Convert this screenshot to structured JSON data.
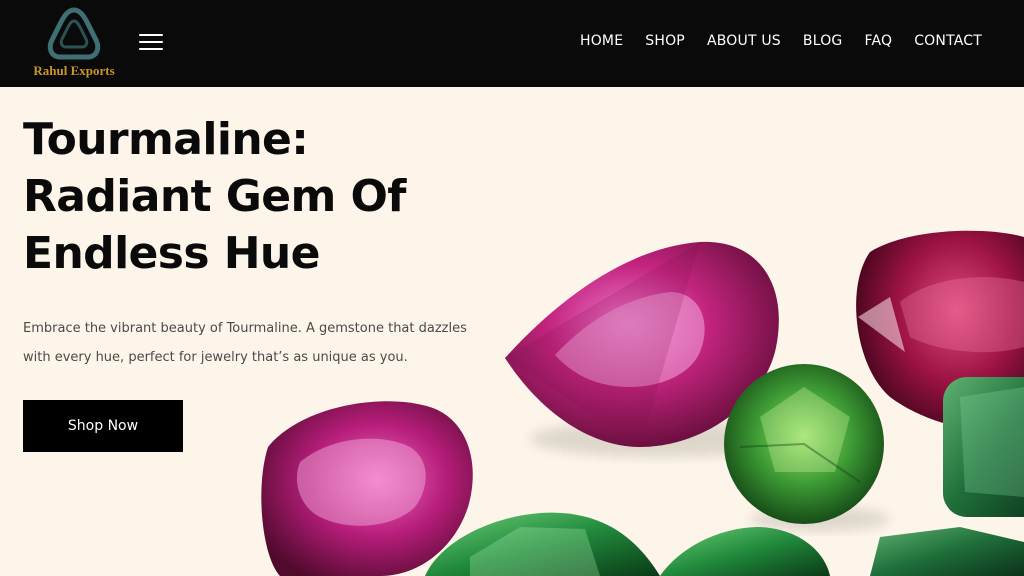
{
  "brand": {
    "name": "Rahul Exports",
    "logo_icon": "triangle-gem-logo"
  },
  "nav": {
    "menu_icon": "hamburger-icon",
    "links": [
      {
        "label": "HOME"
      },
      {
        "label": "SHOP"
      },
      {
        "label": "ABOUT US"
      },
      {
        "label": "BLOG"
      },
      {
        "label": "FAQ"
      },
      {
        "label": "CONTACT"
      }
    ]
  },
  "hero": {
    "title_lines": [
      "Tourmaline:",
      "Radiant Gem Of",
      "Endless Hue"
    ],
    "description_lines": [
      "Embrace the vibrant beauty of Tourmaline. A gemstone that dazzles",
      "with every hue, perfect for jewelry that’s as unique as you."
    ],
    "cta_label": "Shop Now"
  },
  "colors": {
    "nav_background": "#0a0a0a",
    "page_background": "#fdf5e9",
    "brand_gold": "#c9962a",
    "logo_teal": "#3f6e73",
    "button_background": "#000000"
  }
}
